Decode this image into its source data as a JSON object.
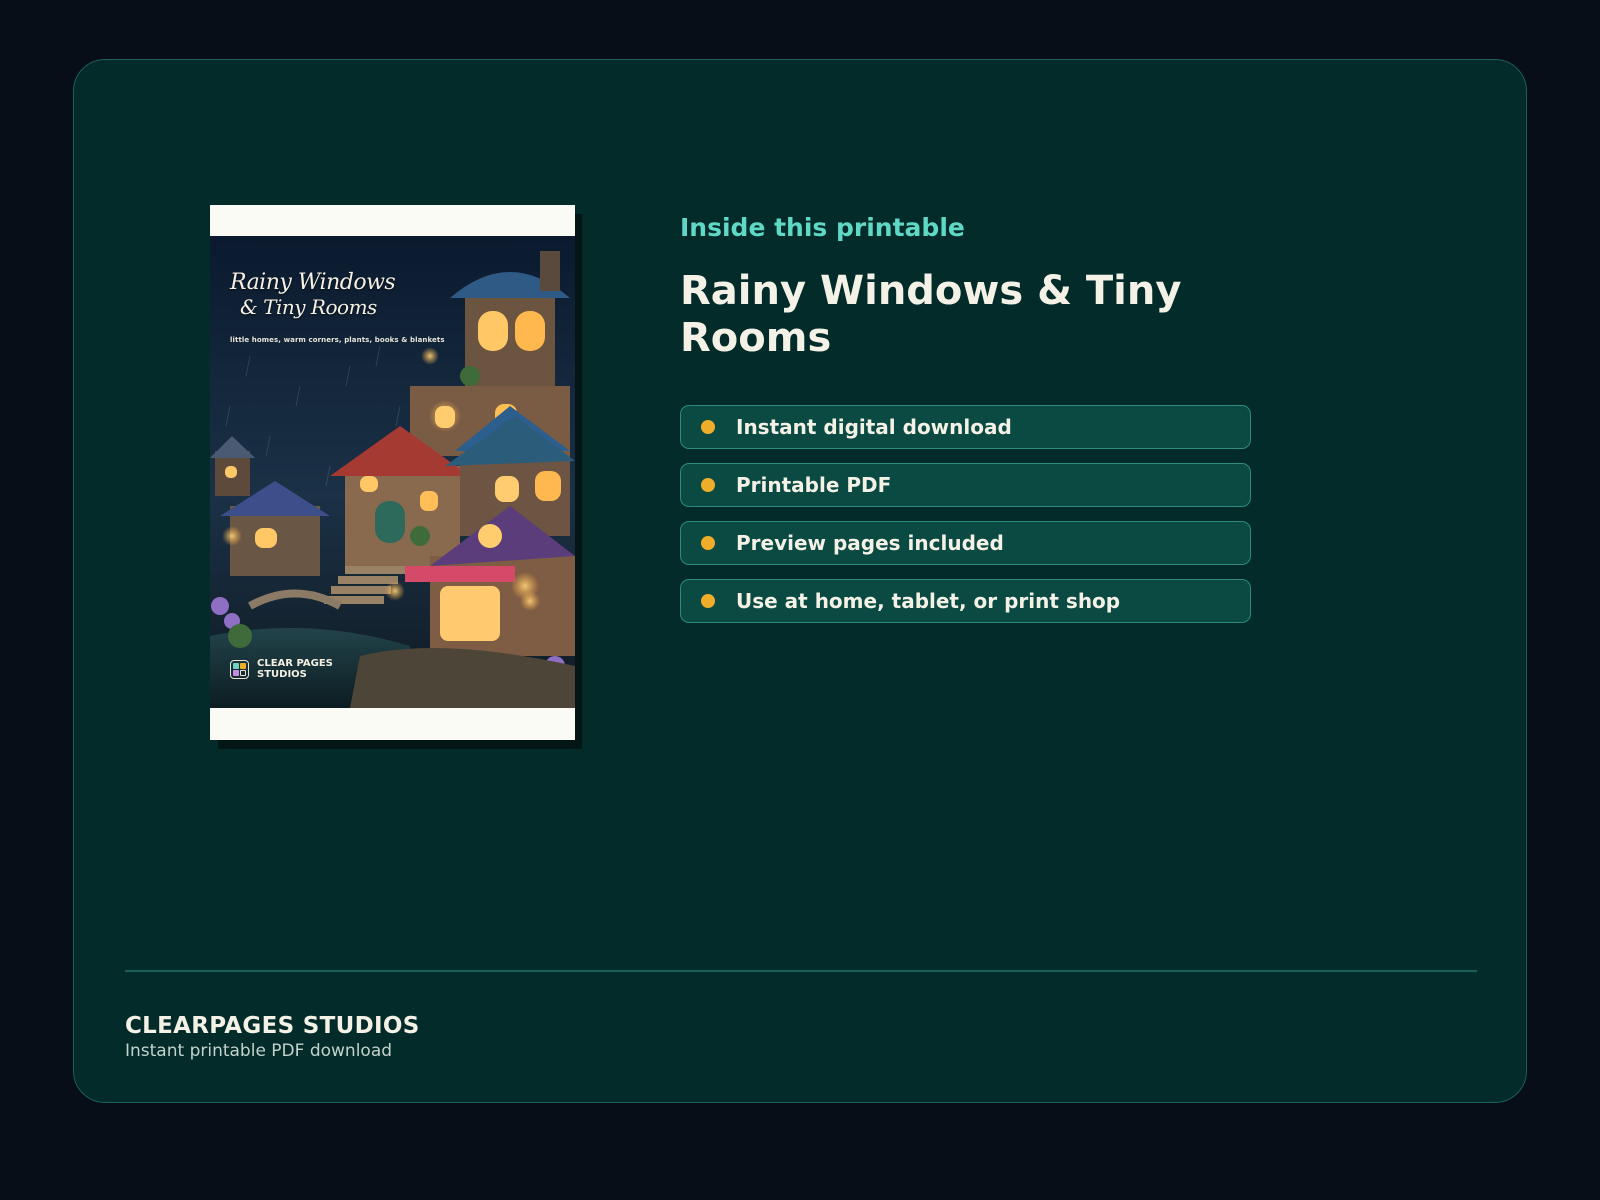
{
  "cover": {
    "title_line1": "Rainy Windows",
    "title_line2": "& Tiny Rooms",
    "tagline": "little homes, warm corners, plants, books & blankets",
    "brand": "CLEAR PAGES\nSTUDIOS",
    "brand_colors": [
      "#6fd3c0",
      "#f0ad2a",
      "#c48be0",
      "#ffffff"
    ]
  },
  "info": {
    "eyebrow": "Inside this printable",
    "headline": "Rainy Windows & Tiny Rooms",
    "features": [
      "Instant digital download",
      "Printable PDF",
      "Preview pages included",
      "Use at home, tablet, or print shop"
    ]
  },
  "footer": {
    "brand": "CLEARPAGES STUDIOS",
    "subtitle": "Instant printable PDF download"
  },
  "colors": {
    "page_bg": "#070e18",
    "panel_bg": "#022b2a",
    "accent_teal": "#5fd8c6",
    "bullet": "#f0ad2a",
    "text": "#f4f1e6"
  }
}
